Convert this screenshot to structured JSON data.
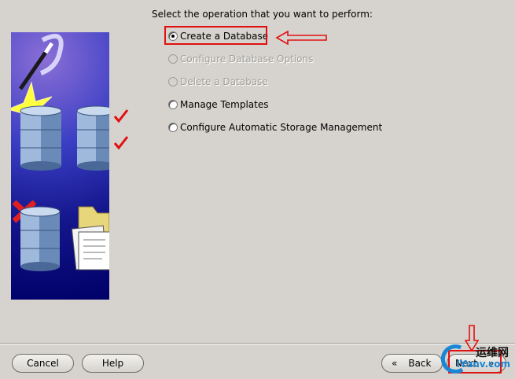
{
  "instruction": "Select the operation that you want to perform:",
  "options": [
    {
      "label": "Create a Database",
      "selected": true,
      "enabled": true
    },
    {
      "label": "Configure Database Options",
      "selected": false,
      "enabled": false
    },
    {
      "label": "Delete a Database",
      "selected": false,
      "enabled": false
    },
    {
      "label": "Manage Templates",
      "selected": false,
      "enabled": true
    },
    {
      "label": "Configure Automatic Storage Management",
      "selected": false,
      "enabled": true
    }
  ],
  "buttons": {
    "cancel": "Cancel",
    "help": "Help",
    "back": "Back",
    "next": "Next"
  },
  "watermark": {
    "cn": "运维网",
    "url": "iYunv.com"
  },
  "colors": {
    "annotation": "#e01010",
    "background": "#d6d3ce",
    "illustration": "#14168c"
  },
  "icons": [
    "magic-wand-icon",
    "database-icon",
    "checklist-icon",
    "delete-x-icon",
    "folder-documents-icon",
    "back-chevron-icon",
    "next-chevron-icon"
  ]
}
